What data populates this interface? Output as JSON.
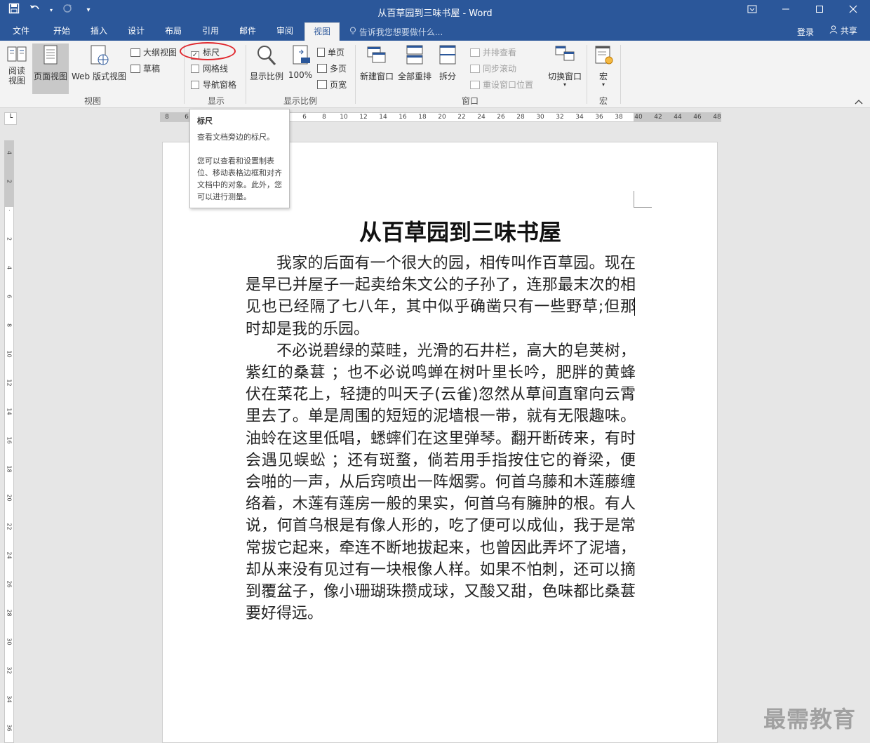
{
  "app": {
    "window_title": "从百草园到三味书屋 - Word",
    "accent": "#2b579a"
  },
  "tabs": {
    "file": "文件",
    "home": "开始",
    "insert": "插入",
    "design": "设计",
    "layout": "布局",
    "references": "引用",
    "mailings": "邮件",
    "review": "审阅",
    "view": "视图",
    "tell_me": "告诉我您想要做什么...",
    "login": "登录",
    "share": "共享"
  },
  "ribbon": {
    "views": {
      "read_mode": "阅读\n视图",
      "print_layout": "页面视图",
      "web_layout": "Web 版式视图",
      "outline": "大纲视图",
      "draft": "草稿",
      "group": "视图"
    },
    "show": {
      "ruler": "标尺",
      "ruler_checked": true,
      "gridlines": "网格线",
      "gridlines_checked": false,
      "nav_pane": "导航窗格",
      "nav_pane_checked": false,
      "group": "显示"
    },
    "zoom": {
      "zoom": "显示比例",
      "hundred": "100%",
      "one_page": "单页",
      "multiple": "多页",
      "page_width": "页宽",
      "group": "显示比例"
    },
    "window": {
      "new_window": "新建窗口",
      "arrange_all": "全部重排",
      "split": "拆分",
      "side_by_side": "并排查看",
      "sync_scroll": "同步滚动",
      "reset_pos": "重设窗口位置",
      "switch": "切换窗口",
      "group": "窗口"
    },
    "macros": {
      "macros": "宏",
      "group": "宏"
    }
  },
  "ruler": {
    "h_ticks": [
      "8",
      "6",
      "4",
      "2",
      "",
      "2",
      "4",
      "6",
      "8",
      "10",
      "12",
      "14",
      "16",
      "18",
      "20",
      "22",
      "24",
      "26",
      "28",
      "30",
      "32",
      "34",
      "36",
      "38",
      "40",
      "42",
      "44",
      "46",
      "48"
    ],
    "v_ticks": [
      "4",
      "2",
      "",
      "2",
      "4",
      "6",
      "8",
      "10",
      "12",
      "14",
      "16",
      "18",
      "20",
      "22",
      "24",
      "26",
      "28",
      "30",
      "32",
      "34",
      "36"
    ]
  },
  "tooltip": {
    "title": "标尺",
    "line1": "查看文档旁边的标尺。",
    "line2": "您可以查看和设置制表位、移动表格边框和对齐文档中的对象。此外，您可以进行测量。"
  },
  "document": {
    "title": "从百草园到三味书屋",
    "paragraphs": [
      "我家的后面有一个很大的园，相传叫作百草园。现在是早已并屋子一起卖给朱文公的子孙了，连那最末次的相见也已经隔了七八年，其中似乎确凿只有一些野草;但那时却是我的乐园。",
      "不必说碧绿的菜畦，光滑的石井栏，高大的皂荚树，紫红的桑葚 ；也不必说鸣蝉在树叶里长吟，肥胖的黄蜂伏在菜花上，轻捷的叫天子(云雀)忽然从草间直窜向云霄里去了。单是周围的短短的泥墙根一带，就有无限趣味。油蛉在这里低唱，蟋蟀们在这里弹琴。翻开断砖来，有时会遇见蜈蚣 ；还有斑蝥，倘若用手指按住它的脊梁，便会啪的一声，从后窍喷出一阵烟雾。何首乌藤和木莲藤缠络着，木莲有莲房一般的果实，何首乌有臃肿的根。有人说，何首乌根是有像人形的，吃了便可以成仙，我于是常常拔它起来，牵连不断地拔起来，也曾因此弄坏了泥墙，却从来没有见过有一块根像人样。如果不怕刺，还可以摘到覆盆子，像小珊瑚珠攒成球，又酸又甜，色味都比桑葚要好得远。"
    ]
  },
  "watermark": "最需教育"
}
